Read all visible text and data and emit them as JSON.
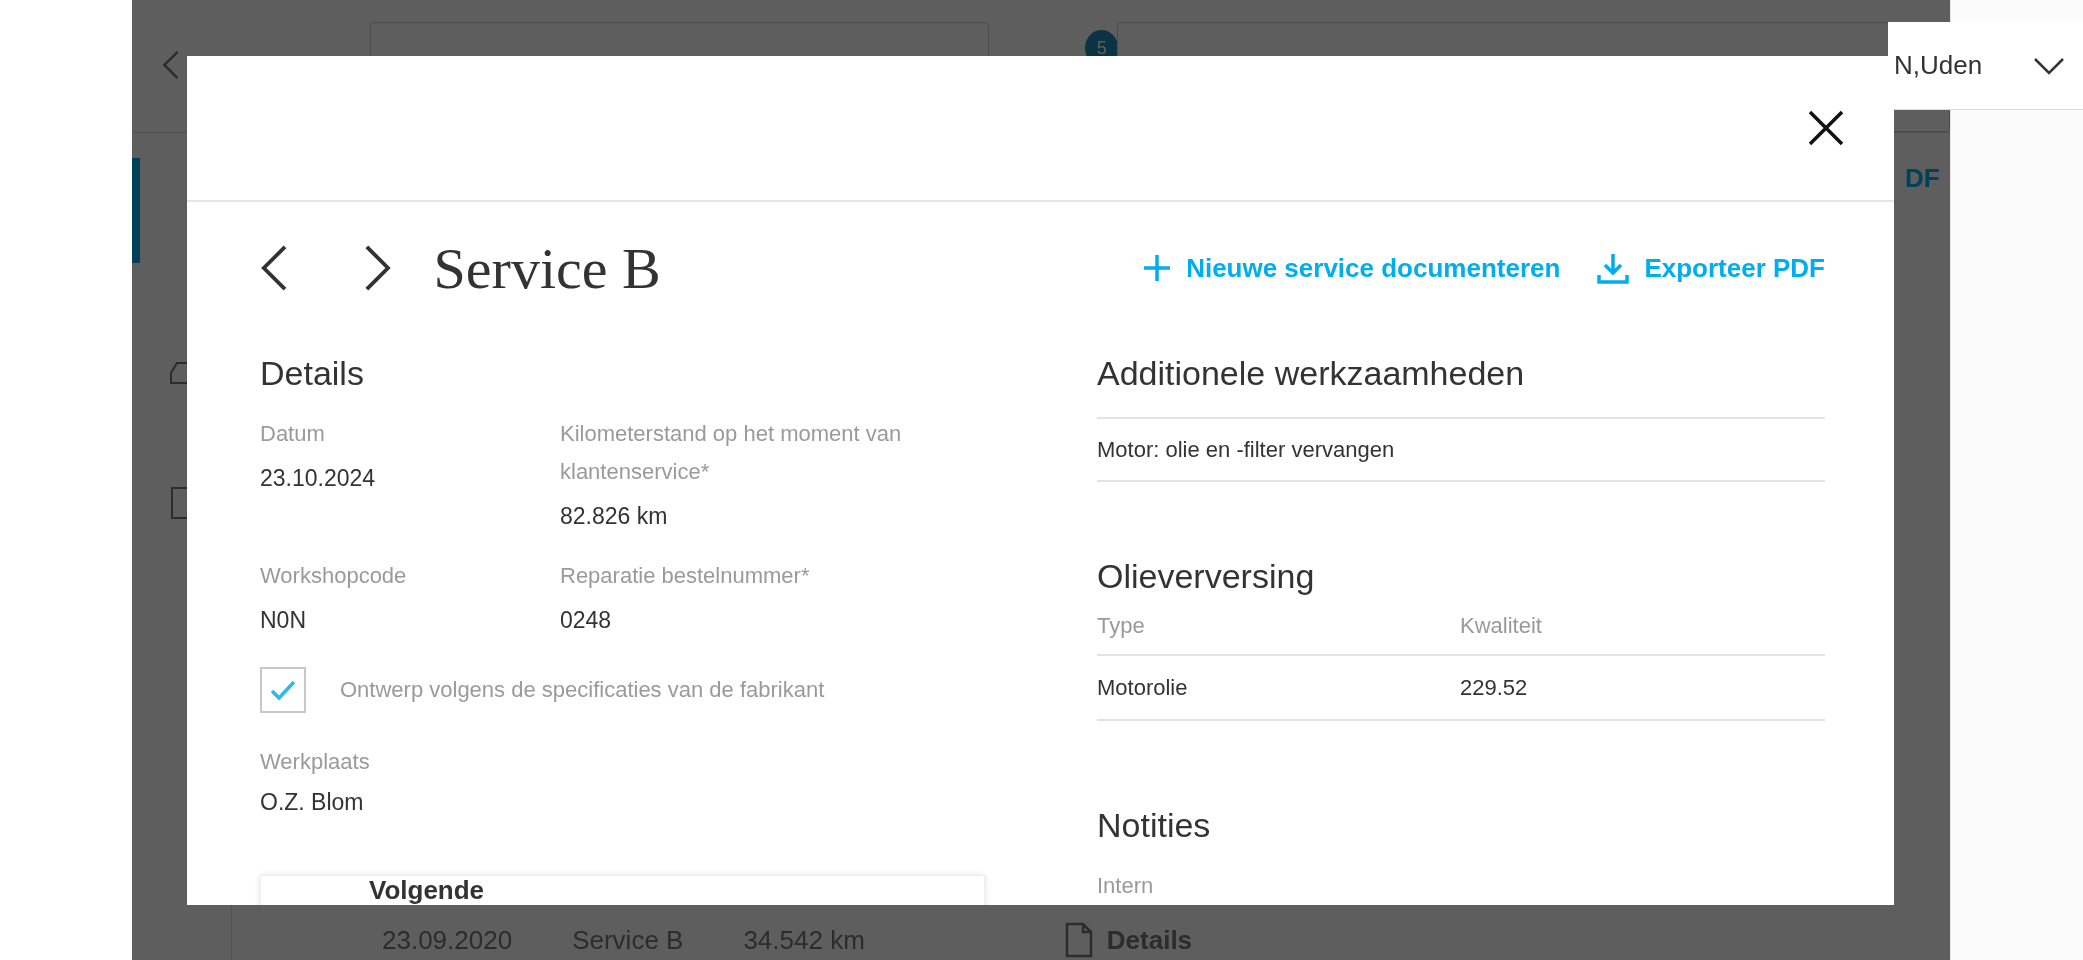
{
  "background": {
    "badge": "5",
    "location": "N,Uden",
    "export_link": "DF",
    "history_row": {
      "date": "23.09.2020",
      "service": "Service B",
      "mileage": "34.542 km",
      "details_link": "Details"
    }
  },
  "modal": {
    "title": "Service B",
    "actions": [
      {
        "kind": "add",
        "label": "Nieuwe service documenteren"
      },
      {
        "kind": "export",
        "label": "Exporteer PDF"
      }
    ],
    "details": {
      "heading": "Details",
      "fields": [
        {
          "label": "Datum",
          "value": "23.10.2024"
        },
        {
          "label": "Kilometerstand op het moment van klantenservice*",
          "value": "82.826 km"
        },
        {
          "label": "Workshopcode",
          "value": "N0N"
        },
        {
          "label": "Reparatie bestelnummer*",
          "value": "0248"
        }
      ],
      "checkbox": {
        "label": "Ontwerp volgens de specificaties van de fabrikant",
        "checked": true
      },
      "workshop": {
        "label": "Werkplaats",
        "value": "O.Z. Blom"
      }
    },
    "next_card": {
      "title": "Volgende"
    },
    "additional_work": {
      "heading": "Additionele werkzaamheden",
      "items": [
        "Motor: olie en -filter vervangen"
      ]
    },
    "oil_change": {
      "heading": "Olieverversing",
      "columns": [
        "Type",
        "Kwaliteit"
      ],
      "rows": [
        [
          "Motorolie",
          "229.52"
        ]
      ]
    },
    "notes": {
      "heading": "Notities",
      "label": "Intern"
    }
  }
}
